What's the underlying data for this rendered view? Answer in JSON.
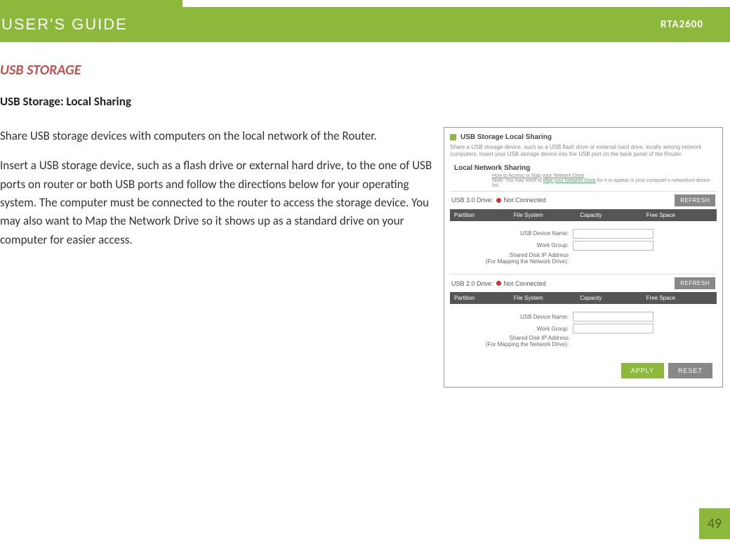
{
  "header": {
    "title": "USER'S GUIDE",
    "model": "RTA2600"
  },
  "section": {
    "title": "USB STORAGE",
    "subtitle": "USB Storage: Local Sharing",
    "p1": "Share USB storage devices with computers on the local network of the Router.",
    "p2": "Insert a USB storage device, such as a flash drive or external hard drive, to the one of USB ports on router or both USB ports and follow the directions below for your operating system.  The computer must be connected to the router to access the storage device.  You may also want to Map the Network Drive so it shows up as a standard drive on your computer for easier access."
  },
  "screenshot": {
    "title": "USB Storage Local Sharing",
    "desc": "Share a USB storage device, such as a USB flash drive or external hard drive, locally among network computers. Insert your USB storage device into the USB port on the back panel of the Router.",
    "sec": "Local Network Sharing",
    "hint_pre": "How to Access or Map your Network Drive",
    "hint_note": "Note: You may need to",
    "hint_link": "Map your Network Drive",
    "hint_post": "for it to appear in your computer's networked device list.",
    "usb30_label": "USB 3.0 Drive:",
    "usb20_label": "USB 2.0 Drive:",
    "not_connected": "Not Connected",
    "refresh": "REFRESH",
    "th_partition": "Partition",
    "th_fs": "File System",
    "th_capacity": "Capacity",
    "th_free": "Free Space",
    "lbl_device": "USB Device Name:",
    "lbl_workgroup": "Work Group:",
    "lbl_ip1": "Shared Disk IP Address",
    "lbl_ip2": "(For Mapping the Network Drive):",
    "apply": "APPLY",
    "reset": "RESET"
  },
  "page_number": "49"
}
